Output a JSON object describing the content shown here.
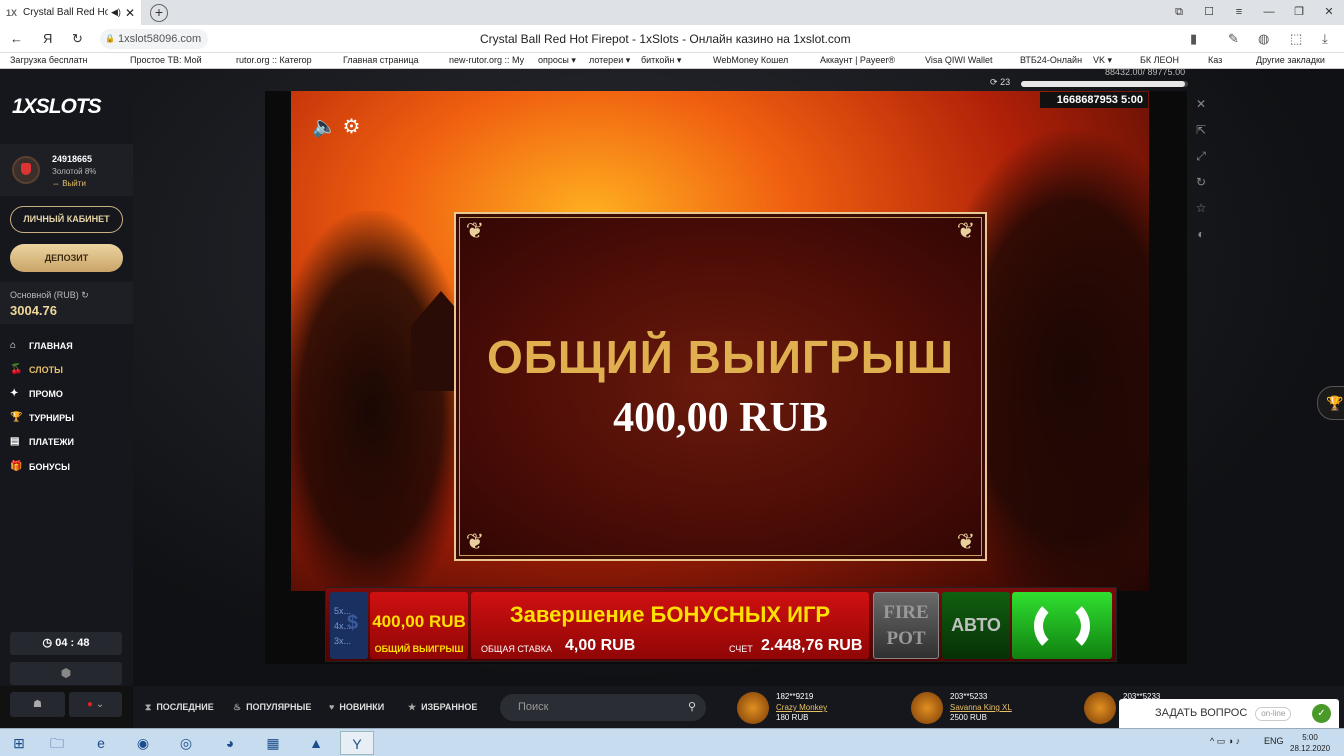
{
  "browser": {
    "tab_title": "Crystal Ball Red Hot",
    "tab_favicon": "1X",
    "url": "1xslot58096.com",
    "page_title": "Crystal Ball Red Hot Firepot - 1xSlots - Онлайн казино на 1xslot.com",
    "bookmarks": [
      {
        "label": "Загрузка бесплатн"
      },
      {
        "label": "Простое ТВ: Мой"
      },
      {
        "label": "rutor.org :: Категор"
      },
      {
        "label": "Главная страница"
      },
      {
        "label": "new-rutor.org :: Му"
      },
      {
        "label": "опросы ▾"
      },
      {
        "label": "лотереи ▾"
      },
      {
        "label": "биткойн ▾"
      },
      {
        "label": "WebMoney Кошел"
      },
      {
        "label": "Аккаунт | Payeer®"
      },
      {
        "label": "Visa QIWI Wallet"
      },
      {
        "label": "ВТБ24-Онлайн"
      },
      {
        "label": "VK ▾"
      },
      {
        "label": "БК ЛЕОН"
      },
      {
        "label": "Каз"
      },
      {
        "label": "Другие закладки"
      }
    ]
  },
  "sidebar": {
    "logo": "1XSLOTS",
    "user_id": "24918665",
    "level": "Золотой 8%",
    "logout": "⇔ Выйти",
    "cabinet_btn": "ЛИЧНЫЙ КАБИНЕТ",
    "deposit_btn": "ДЕПОЗИТ",
    "balance_label": "Основной (RUB)",
    "balance_value": "3004.76",
    "nav": [
      {
        "label": "ГЛАВНАЯ",
        "icon": "home-icon"
      },
      {
        "label": "СЛОТЫ",
        "icon": "cherry-icon"
      },
      {
        "label": "ПРОМО",
        "icon": "promo-icon"
      },
      {
        "label": "ТУРНИРЫ",
        "icon": "trophy-icon"
      },
      {
        "label": "ПЛАТЕЖИ",
        "icon": "wallet-icon"
      },
      {
        "label": "БОНУСЫ",
        "icon": "gift-icon"
      }
    ],
    "timer": "04 : 48"
  },
  "topbar": {
    "progress_count": "23",
    "progress_text": "88432.00/ 89775.00",
    "progress_fraction": 0.985
  },
  "game": {
    "id_time": "1668687953  5:00",
    "win_title": "ОБЩИЙ ВЫИГРЫШ",
    "win_amount": "400,00 RUB",
    "bar": {
      "multipliers": [
        "5x...",
        "4x...",
        "3x..."
      ],
      "win_value": "400,00 RUB",
      "win_label": "ОБЩИЙ ВЫИГРЫШ",
      "headline": "Завершение БОНУСНЫХ ИГР",
      "stake_label": "ОБЩАЯ СТАВКА",
      "stake_value": "4,00 RUB",
      "credit_label": "СЧЕТ",
      "credit_value": "2.448,76 RUB",
      "fire1": "FIRE",
      "fire2": "POT",
      "auto": "АВТО"
    }
  },
  "bottom": {
    "tabs": [
      {
        "label": "ПОСЛЕДНИЕ",
        "icon": "hourglass-icon"
      },
      {
        "label": "ПОПУЛЯРНЫЕ",
        "icon": "fire-icon"
      },
      {
        "label": "НОВИНКИ",
        "icon": "heart-icon"
      },
      {
        "label": "ИЗБРАННОЕ",
        "icon": "star-icon"
      }
    ],
    "search_placeholder": "Поиск",
    "recent": [
      {
        "user": "182**9219",
        "game": "Crazy Monkey",
        "amount": "180 RUB"
      },
      {
        "user": "203**5233",
        "game": "Savanna King XL",
        "amount": "2500 RUB"
      },
      {
        "user": "203**5233",
        "game": "",
        "amount": ""
      }
    ],
    "ask_label": "ЗАДАТЬ ВОПРОС",
    "ask_status": "on-line"
  },
  "taskbar": {
    "lang": "ENG",
    "time": "5:00",
    "date": "28.12.2020"
  }
}
